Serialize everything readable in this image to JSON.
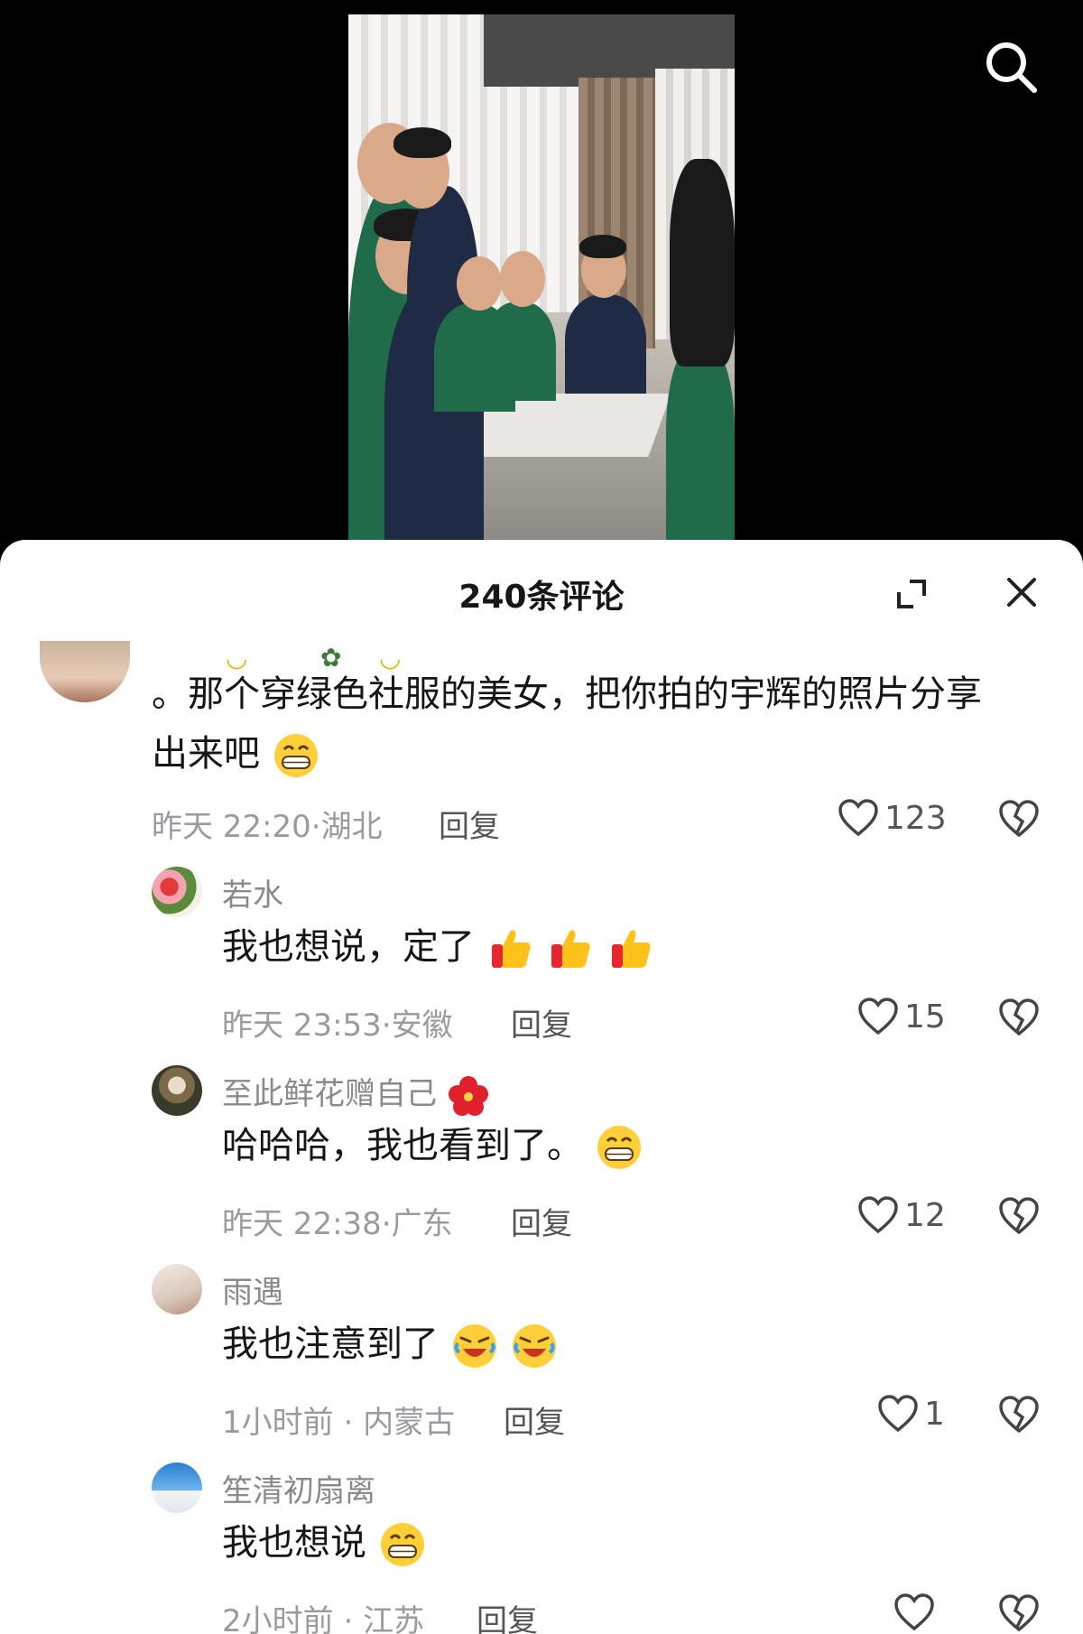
{
  "sheet": {
    "title": "240条评论"
  },
  "comments": [
    {
      "text_line1": "。那个穿绿色社服的美女，把你拍的宇辉的照片分享",
      "text_line2": "出来吧",
      "emoji": "grin-emoji",
      "time": "昨天 22:20",
      "location": "湖北",
      "reply": "回复",
      "likes": "123"
    },
    {
      "user": "若水",
      "text": "我也想说，定了",
      "emoji": "thumbs-up-emoji",
      "time": "昨天 23:53",
      "location": "安徽",
      "reply": "回复",
      "likes": "15"
    },
    {
      "user": "至此鲜花赠自己",
      "user_emoji": "hibiscus-emoji",
      "text": "哈哈哈，我也看到了。",
      "emoji": "grin-emoji",
      "time": "昨天 22:38",
      "location": "广东",
      "reply": "回复",
      "likes": "12"
    },
    {
      "user": "雨遇",
      "text": "我也注意到了",
      "emoji": "rofl-emoji",
      "time": "1小时前",
      "location": "内蒙古",
      "reply": "回复",
      "likes": "1"
    },
    {
      "user": "笙清初扇离",
      "text": "我也想说",
      "emoji": "grin-emoji",
      "time": "2小时前",
      "location": "江苏",
      "reply": "回复"
    }
  ],
  "colors": {
    "sheet_bg": "#ffffff",
    "title": "#161616",
    "meta": "#9a9aa0",
    "username": "#8a8a8e",
    "video_bg": "#000000"
  }
}
